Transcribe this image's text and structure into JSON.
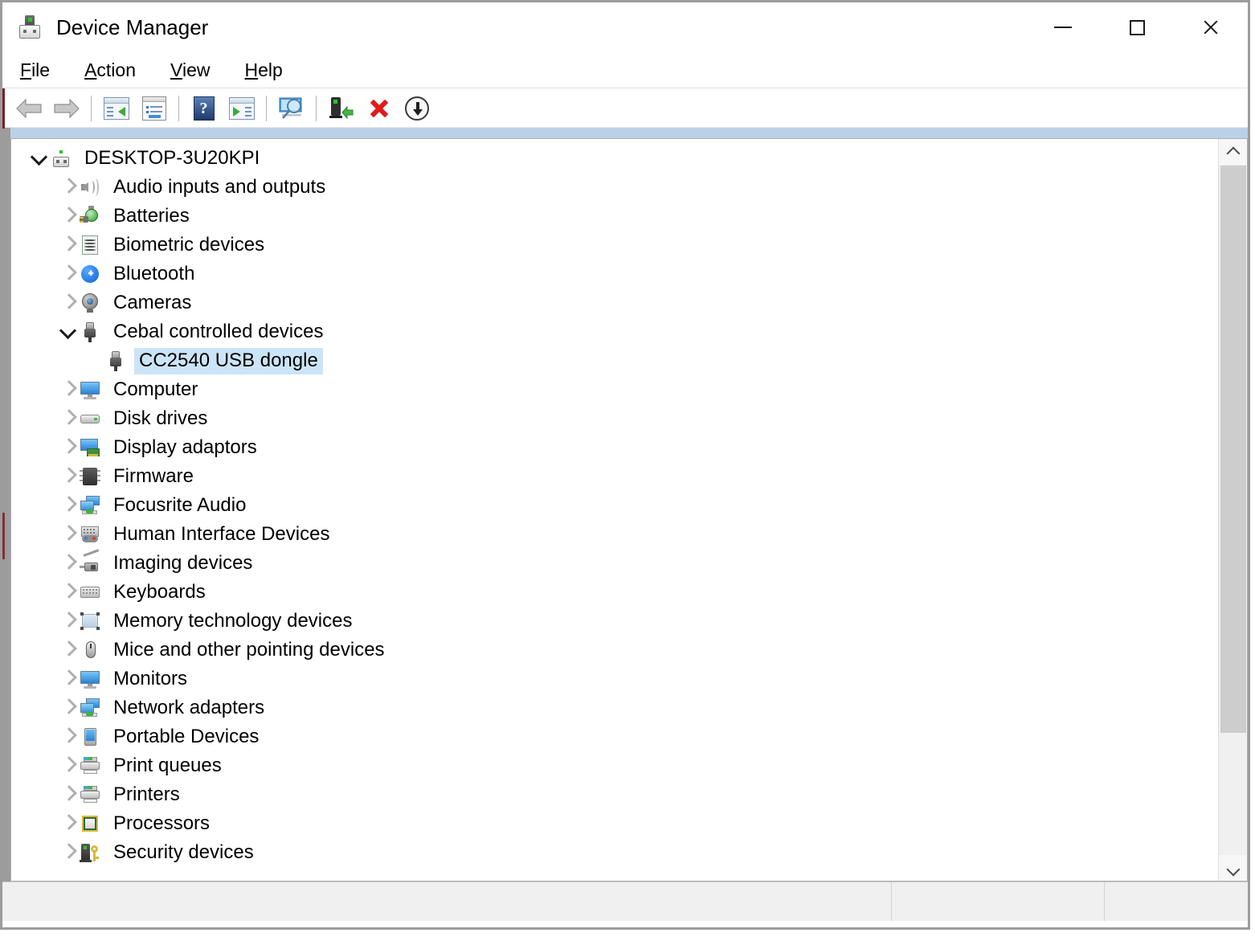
{
  "window": {
    "title": "Device Manager",
    "app_icon": "device-icon",
    "controls": {
      "minimize": "minimize-icon",
      "maximize": "maximize-icon",
      "close": "close-icon"
    }
  },
  "menubar": {
    "items": [
      {
        "label": "File",
        "accel": "F",
        "rest": "ile"
      },
      {
        "label": "Action",
        "accel": "A",
        "rest": "ction"
      },
      {
        "label": "View",
        "accel": "V",
        "rest": "iew"
      },
      {
        "label": "Help",
        "accel": "H",
        "rest": "elp"
      }
    ]
  },
  "toolbar": {
    "buttons": [
      {
        "name": "back-button",
        "icon": "back-arrow-icon"
      },
      {
        "name": "forward-button",
        "icon": "forward-arrow-icon"
      },
      {
        "name": "show-hide-console-tree-button",
        "icon": "console-tree-icon"
      },
      {
        "name": "properties-button",
        "icon": "properties-icon"
      },
      {
        "name": "help-button",
        "icon": "help-question-icon"
      },
      {
        "name": "show-hidden-devices-button",
        "icon": "show-hidden-icon"
      },
      {
        "name": "scan-for-hardware-changes-button",
        "icon": "scan-monitor-magnifier-icon"
      },
      {
        "name": "update-driver-button",
        "icon": "update-driver-icon"
      },
      {
        "name": "uninstall-device-button",
        "icon": "red-x-icon"
      },
      {
        "name": "disable-device-button",
        "icon": "disable-down-arrow-icon"
      }
    ]
  },
  "tree": {
    "root": {
      "label": "DESKTOP-3U20KPI",
      "icon": "computer-device-icon",
      "expanded": true
    },
    "nodes": [
      {
        "label": "Audio inputs and outputs",
        "icon": "speaker-icon",
        "expanded": false,
        "selected": false,
        "level": 1
      },
      {
        "label": "Batteries",
        "icon": "battery-icon",
        "expanded": false,
        "selected": false,
        "level": 1
      },
      {
        "label": "Biometric devices",
        "icon": "fingerprint-icon",
        "expanded": false,
        "selected": false,
        "level": 1
      },
      {
        "label": "Bluetooth",
        "icon": "bluetooth-icon",
        "expanded": false,
        "selected": false,
        "level": 1
      },
      {
        "label": "Cameras",
        "icon": "camera-icon",
        "expanded": false,
        "selected": false,
        "level": 1
      },
      {
        "label": "Cebal controlled devices",
        "icon": "usb-dongle-icon",
        "expanded": true,
        "selected": false,
        "level": 1
      },
      {
        "label": "CC2540 USB dongle",
        "icon": "usb-dongle-icon",
        "expanded": null,
        "selected": true,
        "level": 2
      },
      {
        "label": "Computer",
        "icon": "monitor-icon",
        "expanded": false,
        "selected": false,
        "level": 1
      },
      {
        "label": "Disk drives",
        "icon": "disk-drive-icon",
        "expanded": false,
        "selected": false,
        "level": 1
      },
      {
        "label": "Display adaptors",
        "icon": "display-adapter-icon",
        "expanded": false,
        "selected": false,
        "level": 1
      },
      {
        "label": "Firmware",
        "icon": "firmware-chip-icon",
        "expanded": false,
        "selected": false,
        "level": 1
      },
      {
        "label": "Focusrite Audio",
        "icon": "network-monitors-icon",
        "expanded": false,
        "selected": false,
        "level": 1
      },
      {
        "label": "Human Interface Devices",
        "icon": "hid-keyboard-gamepad-icon",
        "expanded": false,
        "selected": false,
        "level": 1
      },
      {
        "label": "Imaging devices",
        "icon": "scanner-icon",
        "expanded": false,
        "selected": false,
        "level": 1
      },
      {
        "label": "Keyboards",
        "icon": "keyboard-icon",
        "expanded": false,
        "selected": false,
        "level": 1
      },
      {
        "label": "Memory technology devices",
        "icon": "memory-card-icon",
        "expanded": false,
        "selected": false,
        "level": 1
      },
      {
        "label": "Mice and other pointing devices",
        "icon": "mouse-icon",
        "expanded": false,
        "selected": false,
        "level": 1
      },
      {
        "label": "Monitors",
        "icon": "monitor-icon",
        "expanded": false,
        "selected": false,
        "level": 1
      },
      {
        "label": "Network adapters",
        "icon": "network-monitors-icon",
        "expanded": false,
        "selected": false,
        "level": 1
      },
      {
        "label": "Portable Devices",
        "icon": "phone-icon",
        "expanded": false,
        "selected": false,
        "level": 1
      },
      {
        "label": "Print queues",
        "icon": "printer-icon",
        "expanded": false,
        "selected": false,
        "level": 1
      },
      {
        "label": "Printers",
        "icon": "printer-icon",
        "expanded": false,
        "selected": false,
        "level": 1
      },
      {
        "label": "Processors",
        "icon": "cpu-icon",
        "expanded": false,
        "selected": false,
        "level": 1
      },
      {
        "label": "Security devices",
        "icon": "security-key-icon",
        "expanded": false,
        "selected": false,
        "level": 1
      }
    ]
  },
  "scrollbar": {
    "up_icon": "scroll-up-arrow-icon",
    "down_icon": "scroll-down-arrow-icon"
  },
  "statusbar": {
    "pane1": "",
    "pane2": "",
    "pane3": ""
  },
  "colors": {
    "selection": "#cce4f7",
    "accent_band": "#bcd1e8",
    "frame": "#9c9c9c",
    "status_bg": "#f0f0f0"
  }
}
